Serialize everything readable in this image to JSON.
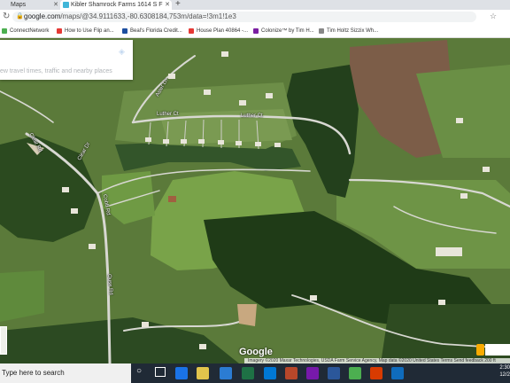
{
  "browser": {
    "tabs": [
      {
        "label": "Maps",
        "active": false
      },
      {
        "label": "Kibler Shamrock Farms 1614 S F",
        "active": true
      }
    ],
    "new_tab_label": "+",
    "url_host": "google.com",
    "url_path": "/maps/@34.9111633,-80.6308184,753m/data=!3m1!1e3",
    "bookmarks": [
      {
        "label": "ConnectNetwork",
        "color": "#4caf50"
      },
      {
        "label": "How to Use Flip an...",
        "color": "#e53935"
      },
      {
        "label": "Beal's Florida Credit...",
        "color": "#1e4fa0"
      },
      {
        "label": "House Plan 40864 -...",
        "color": "#e53935"
      },
      {
        "label": "Colonize™ by Tim H...",
        "color": "#7b1fa2"
      },
      {
        "label": "Tim Holtz Sizzix Wh...",
        "color": "#888888"
      }
    ]
  },
  "map": {
    "search_hint": "ew travel times, traffic and nearby places",
    "street_labels": [
      "Luther Ct",
      "Luther Ct",
      "Aster Ln",
      "Clear Dr",
      "Clear Rd",
      "Cobb Rd",
      "Ouse Rd"
    ],
    "google_logo": "Google",
    "attribution": "Imagery ©2020 Maxar Technologies, USDA Farm Service Agency, Map data ©2020   United States   Terms   Send feedback   200 ft",
    "colors": {
      "field": "#6b8b3e",
      "forest": "#1f3a18",
      "road": "#d9d9d4",
      "plowed": "#7a5a45"
    }
  },
  "taskbar": {
    "search_placeholder": "Type here to search",
    "time": "2:30",
    "date": "12/2"
  }
}
